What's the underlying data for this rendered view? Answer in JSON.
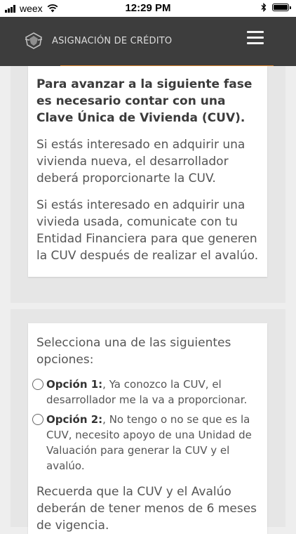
{
  "status_bar": {
    "carrier": "weex",
    "time": "12:29 PM"
  },
  "header": {
    "title": "ASIGNACIÓN DE CRÉDITO",
    "accent_color": "#d9822b",
    "background_color": "#3d3d3d"
  },
  "notice": {
    "heading": "Para avanzar a la siguiente fase es necesario contar con una Clave Única de Vivienda (CUV).",
    "paragraphs": [
      "Si estás interesado en adquirir una vivienda nueva, el desarrollador deberá proporcionarte la CUV.",
      "Si estás interesado en adquirir una vivieda usada, comunicate con tu Entidad Financiera para que generen la CUV después de realizar el avalúo."
    ]
  },
  "options_card": {
    "intro": "Selecciona una de las siguientes opciones:",
    "options": [
      {
        "label": "Opción 1:",
        "text": ", Ya conozco la CUV, el desarrollador me la va a proporcionar."
      },
      {
        "label": "Opción 2:",
        "text": ", No tengo o no se que es la CUV, necesito apoyo de una Unidad de Valuación para generar la CUV y el avalúo."
      }
    ],
    "reminder": "Recuerda que la CUV y el Avalúo deberán de tener menos de 6 meses de vigencia."
  }
}
